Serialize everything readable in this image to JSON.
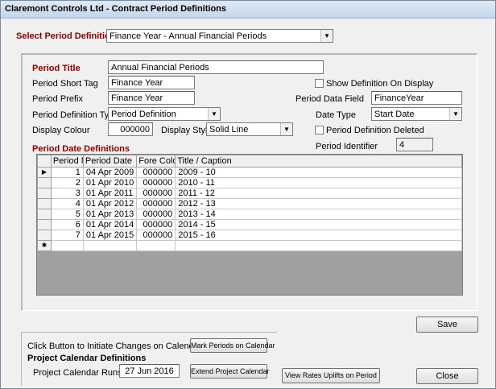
{
  "window": {
    "title": "Claremont Controls Ltd - Contract Period Definitions"
  },
  "select_period": {
    "label": "Select Period Definition",
    "value": "Finance Year - Annual Financial Periods"
  },
  "form": {
    "period_title_label": "Period Title",
    "period_title": "Annual Financial Periods",
    "short_tag_label": "Period Short Tag",
    "short_tag": "Finance Year",
    "prefix_label": "Period Prefix",
    "prefix": "Finance Year",
    "def_type_label": "Period Definition Type",
    "def_type": "Period Definition",
    "display_colour_label": "Display Colour",
    "display_colour": "000000",
    "display_style_label": "Display Style",
    "display_style": "Solid Line",
    "show_on_display_label": "Show Definition On Display",
    "data_field_label": "Period Data Field",
    "data_field": "FinanceYear",
    "date_type_label": "Date Type",
    "date_type": "Start Date",
    "deleted_label": "Period Definition Deleted",
    "identifier_label": "Period Identifier",
    "identifier": "4"
  },
  "grid": {
    "title": "Period Date Definitions",
    "columns": [
      "Period Nu",
      "Period Date",
      "Fore Colour",
      "Title / Caption"
    ],
    "rows": [
      {
        "n": "1",
        "date": "04 Apr 2009",
        "colour": "000000",
        "caption": "2009 - 10"
      },
      {
        "n": "2",
        "date": "01 Apr 2010",
        "colour": "000000",
        "caption": "2010 - 11"
      },
      {
        "n": "3",
        "date": "01 Apr 2011",
        "colour": "000000",
        "caption": "2011 - 12"
      },
      {
        "n": "4",
        "date": "01 Apr 2012",
        "colour": "000000",
        "caption": "2012 - 13"
      },
      {
        "n": "5",
        "date": "01 Apr 2013",
        "colour": "000000",
        "caption": "2013 - 14"
      },
      {
        "n": "6",
        "date": "01 Apr 2014",
        "colour": "000000",
        "caption": "2014 - 15"
      },
      {
        "n": "7",
        "date": "01 Apr 2015",
        "colour": "000000",
        "caption": "2015 - 16"
      }
    ],
    "current_row_glyph": "▶",
    "new_row_glyph": "✱"
  },
  "calendar": {
    "initiate_label": "Click Button to Initiate Changes on Calendar:",
    "mark_button": "Mark Periods on Calendar",
    "section_title": "Project Calendar Definitions",
    "runs_to_label": "Project Calendar Runs to:",
    "runs_to": "27 Jun 2016",
    "extend_button": "Extend Project Calendar"
  },
  "buttons": {
    "view_rates": "View Rates Uplifts on Period",
    "save": "Save",
    "close": "Close"
  },
  "icons": {
    "dropdown": "chevron-down-icon"
  }
}
